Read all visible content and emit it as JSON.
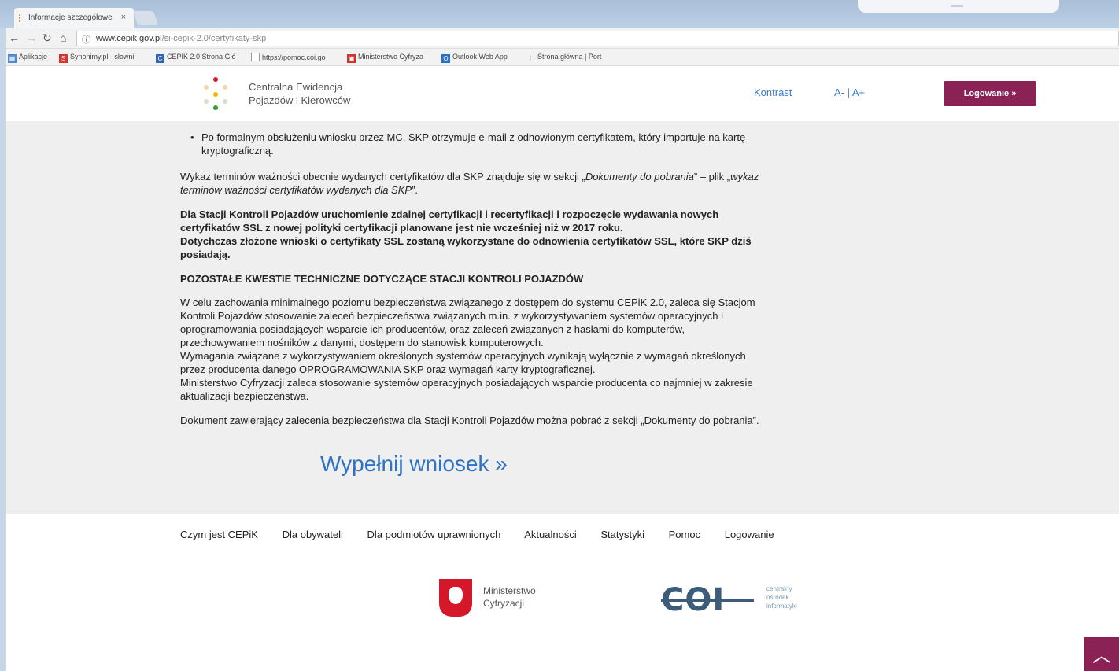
{
  "browser": {
    "tab_title": "Informacje szczegółowe",
    "tab_close": "×",
    "url_host": "www.cepik.gov.pl",
    "url_path": "/si-cepik-2.0/certyfikaty-skp",
    "bookmarks": [
      {
        "label": "Aplikacje",
        "color": "#4a8bd6"
      },
      {
        "label": "Synonimy.pl - słowni",
        "color": "#d4342b"
      },
      {
        "label": "CEPIK 2.0 Strona Głó",
        "color": "#3366aa"
      },
      {
        "label": "https://pomoc.coi.go",
        "color": "#888888"
      },
      {
        "label": "Ministerstwo Cyfryza",
        "color": "#d4342b"
      },
      {
        "label": "Outlook Web App",
        "color": "#2b6fc2"
      },
      {
        "label": "Strona główna | Port",
        "color": "#d9a23a"
      }
    ]
  },
  "header": {
    "logo_line1": "Centralna Ewidencja",
    "logo_line2": "Pojazdów i Kierowców",
    "contrast": "Kontrast",
    "font_size": "A- | A+",
    "login": "Logowanie »"
  },
  "content": {
    "bullet": "Po formalnym obsłużeniu wniosku przez MC, SKP otrzymuje e-mail z odnowionym certyfikatem, który importuje na kartę kryptograficzną.",
    "p1_start": "Wykaz terminów ważności obecnie wydanych certyfikatów dla SKP znajduje się w sekcji „",
    "p1_em1": "Dokumenty do pobrania",
    "p1_mid": "” – plik „",
    "p1_em2": "wykaz terminów ważności certyfikatów wydanych dla SKP",
    "p1_end": "”.",
    "bold1": "Dla Stacji Kontroli Pojazdów uruchomienie zdalnej certyfikacji i recertyfikacji i rozpoczęcie wydawania nowych certyfikatów SSL z nowej polityki certyfikacji planowane jest nie wcześniej niż w 2017 roku.",
    "bold2": "Dotychczas złożone wnioski o certyfikaty SSL zostaną wykorzystane do odnowienia certyfikatów SSL, które SKP dziś posiadają.",
    "heading": "POZOSTAŁE KWESTIE TECHNICZNE DOTYCZĄCE STACJI KONTROLI POJAZDÓW",
    "p2a": "W celu zachowania minimalnego poziomu bezpieczeństwa związanego z dostępem do systemu CEPiK 2.0, zaleca się Stacjom Kontroli Pojazdów stosowanie zaleceń bezpieczeństwa związanych m.in. z wykorzystywaniem systemów operacyjnych i oprogramowania posiadających wsparcie ich producentów, oraz zaleceń związanych z hasłami do komputerów, przechowywaniem nośników z danymi, dostępem do stanowisk komputerowych.",
    "p2b": "Wymagania związane z wykorzystywaniem określonych systemów operacyjnych wynikają wyłącznie z wymagań określonych przez producenta danego OPROGRAMOWANIA SKP oraz wymagań karty kryptograficznej.",
    "p2c": "Ministerstwo Cyfryzacji zaleca stosowanie systemów operacyjnych posiadających wsparcie producenta co najmniej w zakresie aktualizacji bezpieczeństwa.",
    "p3": "Dokument zawierający zalecenia bezpieczeństwa dla Stacji Kontroli Pojazdów można pobrać z sekcji „Dokumenty do pobrania”.",
    "cta": "Wypełnij wniosek »"
  },
  "footer": {
    "nav": [
      "Czym jest CEPiK",
      "Dla obywateli",
      "Dla podmiotów uprawnionych",
      "Aktualności",
      "Statystyki",
      "Pomoc",
      "Logowanie"
    ],
    "mc_line1": "Ministerstwo",
    "mc_line2": "Cyfryzacji",
    "coi_logo": "COI",
    "coi_line1": "centralny",
    "coi_line2": "ośrodek",
    "coi_line3": "informatyki"
  },
  "colors": {
    "accent": "#8b2256",
    "link": "#3a7bc8"
  }
}
